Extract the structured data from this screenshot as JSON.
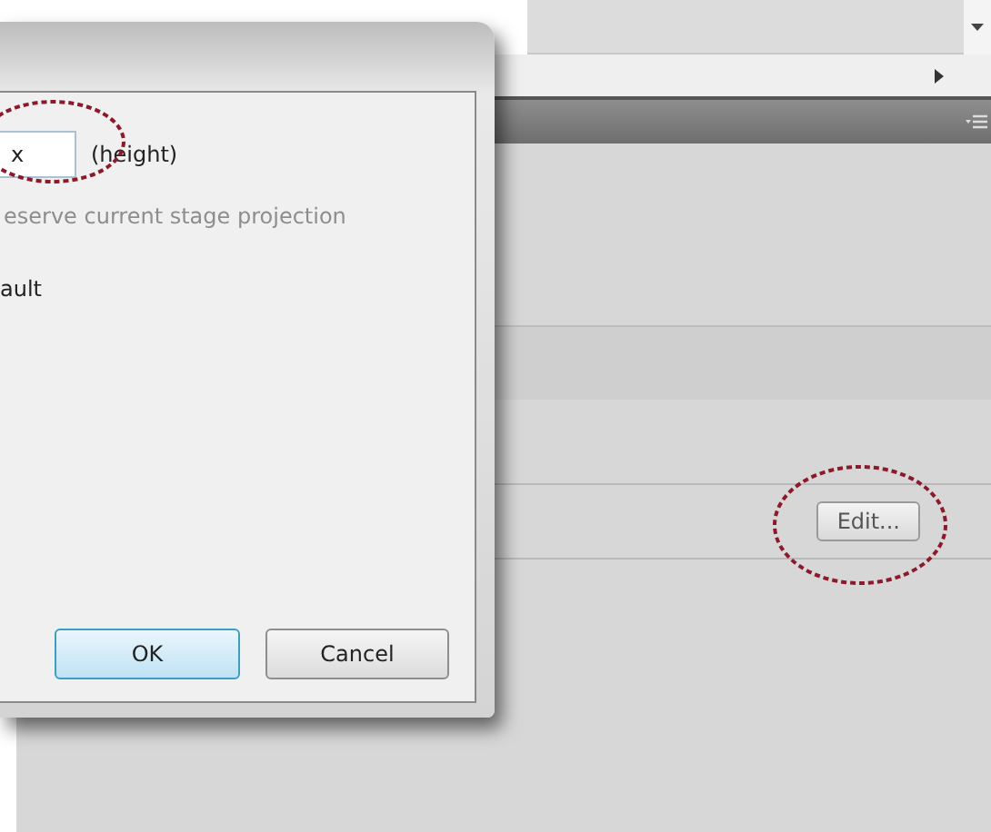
{
  "dialog": {
    "height_field": {
      "value": "x"
    },
    "height_label": "(height)",
    "preserve_option": {
      "label": "eserve current stage projection",
      "disabled": true
    },
    "default_label": "ault",
    "buttons": [
      {
        "label": "OK",
        "kind": "default"
      },
      {
        "label": "Cancel",
        "kind": "normal"
      }
    ]
  },
  "panel": {
    "edit_button": "Edit..."
  }
}
